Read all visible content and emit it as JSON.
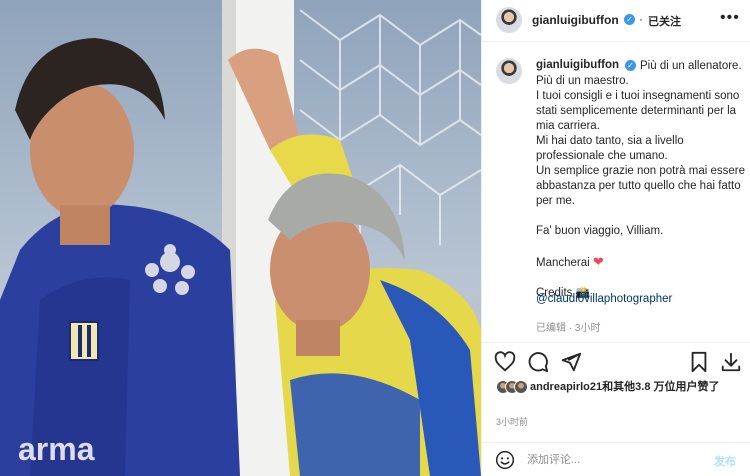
{
  "post": {
    "username": "gianluigibuffon",
    "verified_icon": "verified-badge-icon",
    "follow_status": "已关注",
    "more_icon": "more-options-icon"
  },
  "caption": {
    "username": "gianluigibuffon",
    "text": "Più di un allenatore. Più di un maestro.\nI tuoi consigli e i tuoi insegnamenti sono stati semplicemente determinanti per la mia carriera.\nMi hai dato tanto, sia a livello professionale che umano.\nUn semplice grazie non potrà mai essere abbastanza per tutto quello che hai fatto per me.\n\nFa' buon viaggio, Villiam.\n\nMancherai",
    "heart": "❤",
    "credits_label": "Credits",
    "credits_icon": "📸",
    "link": "@claudiovillaphotographer",
    "edited": "已编辑",
    "sep": "·",
    "age": "3小时"
  },
  "actions": {
    "like_icon": "heart-outline-icon",
    "comment_icon": "comment-icon",
    "share_icon": "send-icon",
    "save_icon": "bookmark-icon",
    "download_icon": "download-icon"
  },
  "likes": {
    "text": "andreapirlo21和其他3.8 万位用户赞了"
  },
  "timestamp": "3小时前",
  "comment": {
    "placeholder": "添加评论...",
    "post_label": "发布",
    "emoji_icon": "emoji-icon"
  },
  "colors": {
    "link": "#00376b",
    "verified": "#3897f0",
    "post_button_disabled": "#b2dffc",
    "heart": "#ed4956"
  }
}
